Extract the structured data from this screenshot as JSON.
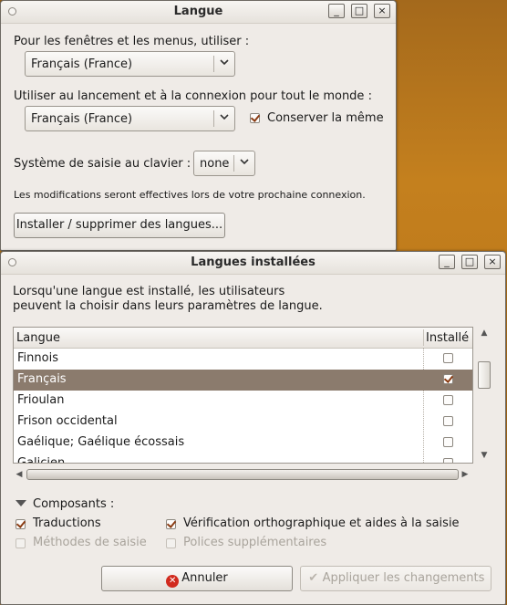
{
  "window1": {
    "title": "Langue",
    "menu_label": "Pour les fenêtres et les menus, utiliser :",
    "menu_lang": "Français (France)",
    "startup_label": "Utiliser au lancement et à la connexion pour tout le monde :",
    "startup_lang": "Français (France)",
    "keep_same_label": "Conserver la même",
    "keep_same_checked": true,
    "input_label": "Système de saisie au clavier :",
    "input_value": "none",
    "notice": "Les modifications seront effectives lors de votre prochaine connexion.",
    "install_button": "Installer / supprimer des langues..."
  },
  "window2": {
    "title": "Langues installées",
    "description_line1": "Lorsqu'une langue est installé, les utilisateurs",
    "description_line2": "peuvent la choisir dans leurs paramètres de langue.",
    "table": {
      "col_language": "Langue",
      "col_installed": "Installé",
      "rows": [
        {
          "name": "Finnois",
          "installed": false,
          "selected": false
        },
        {
          "name": "Français",
          "installed": true,
          "selected": true
        },
        {
          "name": "Frioulan",
          "installed": false,
          "selected": false
        },
        {
          "name": "Frison occidental",
          "installed": false,
          "selected": false
        },
        {
          "name": "Gaélique; Gaélique écossais",
          "installed": false,
          "selected": false
        },
        {
          "name": "Galicien",
          "installed": false,
          "selected": false
        }
      ]
    },
    "components_label": "Composants :",
    "components": {
      "translations": {
        "label": "Traductions",
        "checked": true,
        "enabled": true
      },
      "spellcheck": {
        "label": "Vérification orthographique et aides à la saisie",
        "checked": true,
        "enabled": true
      },
      "input_methods": {
        "label": "Méthodes de saisie",
        "checked": false,
        "enabled": false
      },
      "extra_fonts": {
        "label": "Polices supplémentaires",
        "checked": false,
        "enabled": false
      }
    },
    "cancel_button": "Annuler",
    "apply_button": "Appliquer les changements"
  },
  "titlebar_buttons": {
    "minimize": "_",
    "maximize": "□",
    "close": "×"
  },
  "colors": {
    "selection": "#8b7b6d",
    "check": "#8a3b12",
    "desktop": "#b8761c",
    "cancel_icon": "#d12a1e"
  }
}
